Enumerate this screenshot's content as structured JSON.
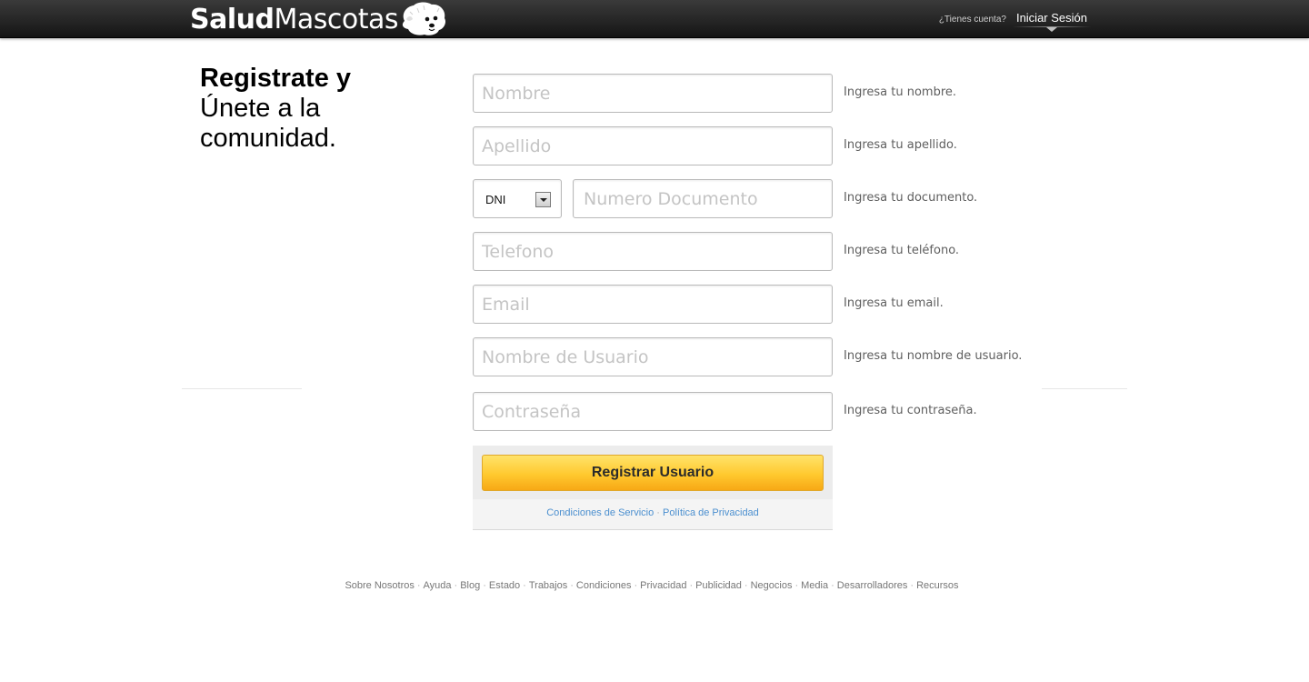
{
  "header": {
    "logo_bold": "Salud",
    "logo_light": "Mascotas",
    "login_question": "¿Tienes cuenta?",
    "login_link": "Iniciar Sesión"
  },
  "heading": {
    "line1": "Registrate y",
    "line2": "Únete a la comunidad."
  },
  "form": {
    "nombre": {
      "placeholder": "Nombre",
      "hint": "Ingresa tu nombre."
    },
    "apellido": {
      "placeholder": "Apellido",
      "hint": "Ingresa tu apellido."
    },
    "doc_type": {
      "value": "DNI"
    },
    "documento": {
      "placeholder": "Numero Documento",
      "hint": "Ingresa tu documento."
    },
    "telefono": {
      "placeholder": "Telefono",
      "hint": "Ingresa tu teléfono."
    },
    "email": {
      "placeholder": "Email",
      "hint": "Ingresa tu email."
    },
    "usuario": {
      "placeholder": "Nombre de Usuario",
      "hint": "Ingresa tu nombre de usuario."
    },
    "contrasena": {
      "placeholder": "Contraseña",
      "hint": "Ingresa tu contraseña."
    },
    "submit_label": "Registrar Usuario",
    "terms_link": "Condiciones de Servicio",
    "privacy_link": "Política de Privacidad"
  },
  "footer": {
    "links": [
      "Sobre Nosotros",
      "Ayuda",
      "Blog",
      "Estado",
      "Trabajos",
      "Condiciones",
      "Privacidad",
      "Publicidad",
      "Negocios",
      "Media",
      "Desarrolladores",
      "Recursos"
    ]
  },
  "colors": {
    "header_bg": "#1f1f1f",
    "button_yellow": "#ffc92f",
    "link_blue": "#4b8fcf"
  }
}
